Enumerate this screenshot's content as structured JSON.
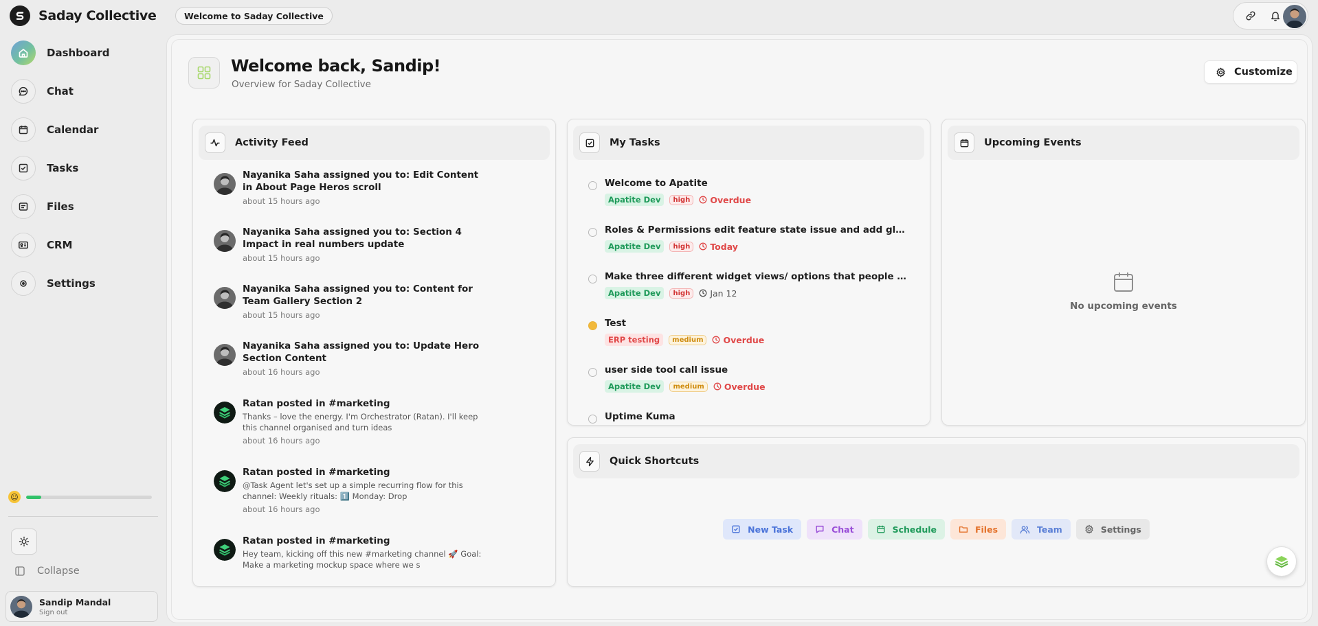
{
  "app": {
    "name": "Saday Collective"
  },
  "breadcrumb": "Welcome to Saday Collective",
  "sidebar": {
    "items": [
      {
        "label": "Dashboard",
        "icon": "home-icon"
      },
      {
        "label": "Chat",
        "icon": "chat-icon"
      },
      {
        "label": "Calendar",
        "icon": "calendar-icon"
      },
      {
        "label": "Tasks",
        "icon": "checkbox-icon"
      },
      {
        "label": "Files",
        "icon": "files-icon"
      },
      {
        "label": "CRM",
        "icon": "id-card-icon"
      },
      {
        "label": "Settings",
        "icon": "settings-icon"
      }
    ],
    "active_index": 0,
    "progress_fraction": 0.12,
    "collapse_label": "Collapse",
    "user": {
      "name": "Sandip Mandal",
      "action": "Sign out"
    }
  },
  "header": {
    "title": "Welcome back, Sandip!",
    "subtitle": "Overview for Saday Collective",
    "customize_label": "Customize"
  },
  "activity": {
    "title": "Activity Feed",
    "items": [
      {
        "title": "Nayanika Saha assigned you to: Edit Content in About Page Heros scroll",
        "message": "",
        "time": "about 15 hours ago",
        "avatar": "person"
      },
      {
        "title": "Nayanika Saha assigned you to: Section 4 Impact in real numbers update",
        "message": "",
        "time": "about 15 hours ago",
        "avatar": "person"
      },
      {
        "title": "Nayanika Saha assigned you to: Content for Team Gallery Section 2",
        "message": "",
        "time": "about 15 hours ago",
        "avatar": "person"
      },
      {
        "title": "Nayanika Saha assigned you to: Update Hero Section Content",
        "message": "",
        "time": "about 16 hours ago",
        "avatar": "person"
      },
      {
        "title": "Ratan posted in #marketing",
        "message": "Thanks – love the energy. I'm Orchestrator (Ratan). I'll keep this channel organised and turn ideas",
        "time": "about 16 hours ago",
        "avatar": "bot"
      },
      {
        "title": "Ratan posted in #marketing",
        "message": "@Task Agent let's set up a simple recurring flow for this channel: Weekly rituals: 1️⃣ Monday: Drop",
        "time": "about 16 hours ago",
        "avatar": "bot"
      },
      {
        "title": "Ratan posted in #marketing",
        "message": "Hey team, kicking off this new #marketing channel 🚀 Goal: Make a marketing mockup space where we s",
        "time": "",
        "avatar": "bot"
      }
    ]
  },
  "tasks": {
    "title": "My Tasks",
    "items": [
      {
        "title": "Welcome to Apatite",
        "project": "Apatite Dev",
        "project_style": "apatite",
        "priority": "high",
        "due": "Overdue",
        "due_style": "red",
        "dot": "empty"
      },
      {
        "title": "Roles & Permissions edit feature state issue and add glass scr...",
        "project": "Apatite Dev",
        "project_style": "apatite",
        "priority": "high",
        "due": "Today",
        "due_style": "red",
        "dot": "empty"
      },
      {
        "title": "Make three different widget views/ options that people can c...",
        "project": "Apatite Dev",
        "project_style": "apatite",
        "priority": "high",
        "due": "Jan 12",
        "due_style": "plain",
        "dot": "empty"
      },
      {
        "title": "Test",
        "project": "ERP testing",
        "project_style": "erp",
        "priority": "medium",
        "due": "Overdue",
        "due_style": "red",
        "dot": "mid"
      },
      {
        "title": "user side tool call issue",
        "project": "Apatite Dev",
        "project_style": "apatite",
        "priority": "medium",
        "due": "Overdue",
        "due_style": "red",
        "dot": "empty"
      },
      {
        "title": "Uptime Kuma",
        "project": "",
        "project_style": "",
        "priority": "",
        "due": "",
        "due_style": "",
        "dot": "empty"
      }
    ]
  },
  "events": {
    "title": "Upcoming Events",
    "empty_text": "No upcoming events"
  },
  "shortcuts": {
    "title": "Quick Shortcuts",
    "items": [
      {
        "label": "New Task",
        "icon": "checkbox-icon",
        "color": "#4b74d9",
        "bg": "#dfe7fb"
      },
      {
        "label": "Chat",
        "icon": "chat-icon",
        "color": "#9a4fd8",
        "bg": "#efe2fa"
      },
      {
        "label": "Schedule",
        "icon": "calendar-icon",
        "color": "#1f9a5a",
        "bg": "#dcf2e5"
      },
      {
        "label": "Files",
        "icon": "folder-icon",
        "color": "#e4732c",
        "bg": "#fde6d8"
      },
      {
        "label": "Team",
        "icon": "users-icon",
        "color": "#5a7fd6",
        "bg": "#e2e8f8"
      },
      {
        "label": "Settings",
        "icon": "settings-icon",
        "color": "#666666",
        "bg": "#e8e8e8"
      }
    ]
  }
}
